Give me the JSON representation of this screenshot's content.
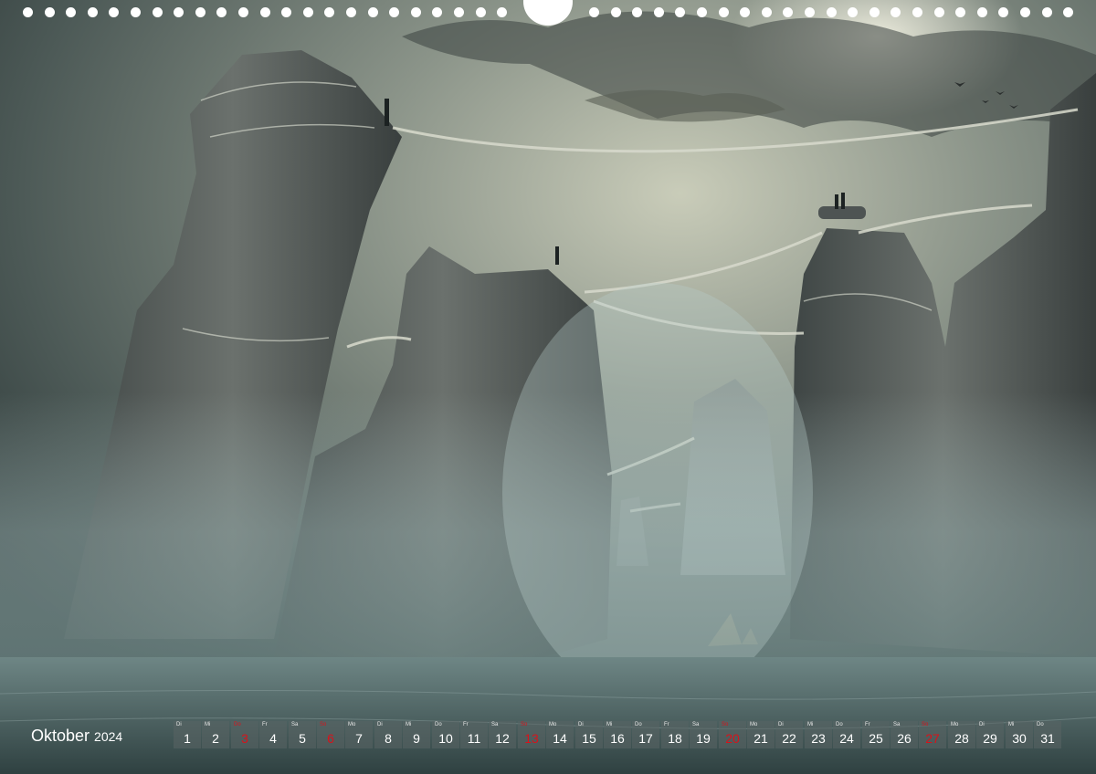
{
  "calendar": {
    "month": "Oktober",
    "year": "2024",
    "sunday_color": "#d8131b",
    "days": [
      {
        "wd": "Di",
        "d": "1",
        "sun": false
      },
      {
        "wd": "Mi",
        "d": "2",
        "sun": false
      },
      {
        "wd": "Do",
        "d": "3",
        "sun": true
      },
      {
        "wd": "Fr",
        "d": "4",
        "sun": false
      },
      {
        "wd": "Sa",
        "d": "5",
        "sun": false
      },
      {
        "wd": "So",
        "d": "6",
        "sun": true
      },
      {
        "wd": "Mo",
        "d": "7",
        "sun": false
      },
      {
        "wd": "Di",
        "d": "8",
        "sun": false
      },
      {
        "wd": "Mi",
        "d": "9",
        "sun": false
      },
      {
        "wd": "Do",
        "d": "10",
        "sun": false
      },
      {
        "wd": "Fr",
        "d": "11",
        "sun": false
      },
      {
        "wd": "Sa",
        "d": "12",
        "sun": false
      },
      {
        "wd": "So",
        "d": "13",
        "sun": true
      },
      {
        "wd": "Mo",
        "d": "14",
        "sun": false
      },
      {
        "wd": "Di",
        "d": "15",
        "sun": false
      },
      {
        "wd": "Mi",
        "d": "16",
        "sun": false
      },
      {
        "wd": "Do",
        "d": "17",
        "sun": false
      },
      {
        "wd": "Fr",
        "d": "18",
        "sun": false
      },
      {
        "wd": "Sa",
        "d": "19",
        "sun": false
      },
      {
        "wd": "So",
        "d": "20",
        "sun": true
      },
      {
        "wd": "Mo",
        "d": "21",
        "sun": false
      },
      {
        "wd": "Di",
        "d": "22",
        "sun": false
      },
      {
        "wd": "Mi",
        "d": "23",
        "sun": false
      },
      {
        "wd": "Do",
        "d": "24",
        "sun": false
      },
      {
        "wd": "Fr",
        "d": "25",
        "sun": false
      },
      {
        "wd": "Sa",
        "d": "26",
        "sun": false
      },
      {
        "wd": "So",
        "d": "27",
        "sun": true
      },
      {
        "wd": "Mo",
        "d": "28",
        "sun": false
      },
      {
        "wd": "Di",
        "d": "29",
        "sun": false
      },
      {
        "wd": "Mi",
        "d": "30",
        "sun": false
      },
      {
        "wd": "Do",
        "d": "31",
        "sun": false
      }
    ]
  }
}
